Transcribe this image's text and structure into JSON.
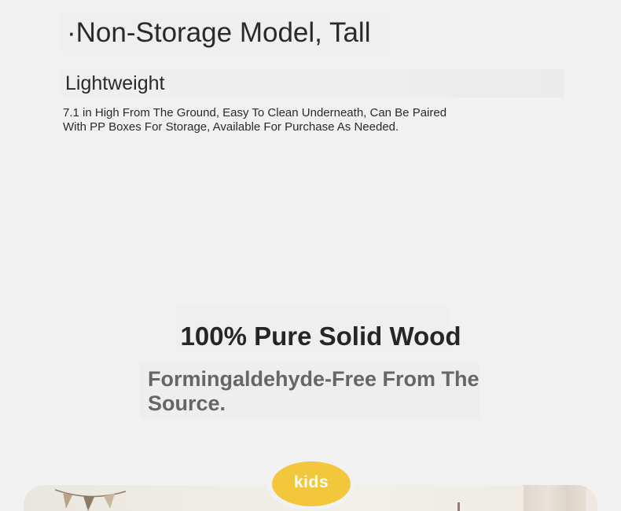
{
  "header": {
    "title": "·Non-Storage Model, Tall",
    "subtitle": "Lightweight",
    "description": "7.1 in High From The Ground, Easy To Clean Underneath, Can Be Paired With PP Boxes For Storage, Available For Purchase As Needed."
  },
  "feature": {
    "title": "100% Pure Solid Wood",
    "subtitle": "Formingaldehyde-Free From The Source."
  },
  "badge": {
    "label": "kids"
  },
  "colors": {
    "background": "#f1f1f1",
    "badge": "#f3c73b",
    "secondary_text": "#666666"
  }
}
